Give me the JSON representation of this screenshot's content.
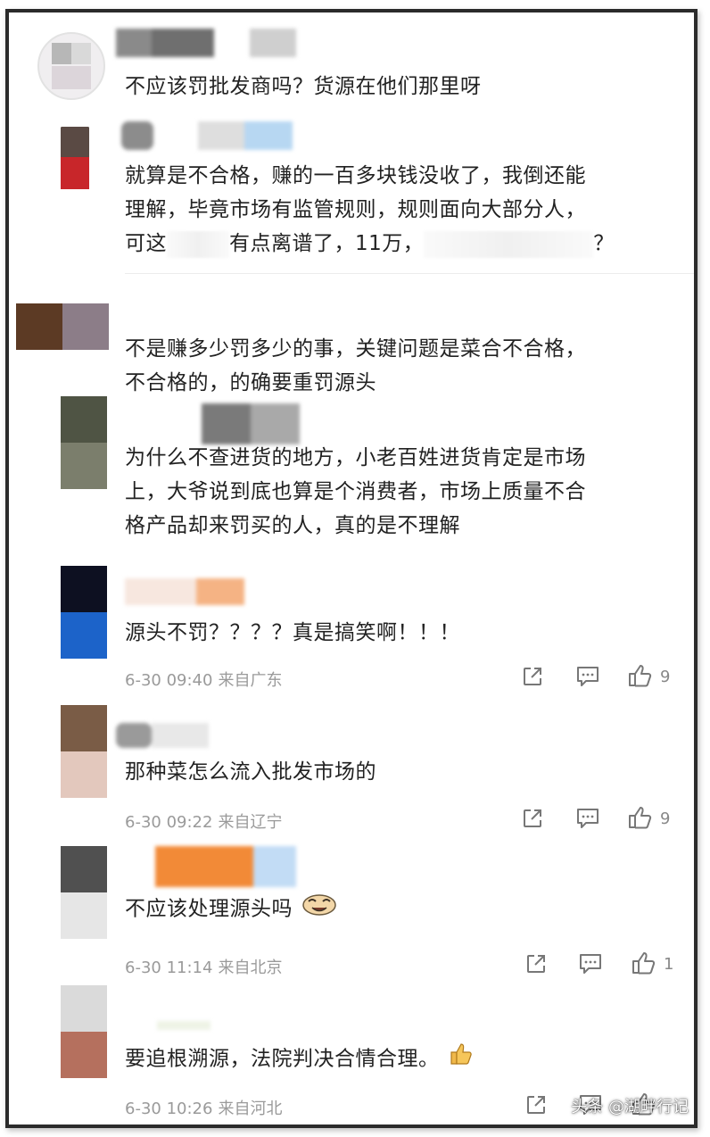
{
  "comments": [
    {
      "lines": [
        "不应该罚批发商吗？货源在他们那里呀"
      ]
    },
    {
      "lines": [
        "就算是不合格，赚的一百多块钱没收了，我倒还能",
        "理解，毕竟市场有监管规则，规则面向大部分人，"
      ],
      "line3_a": "可这",
      "line3_b": "有点离谱了，11万，",
      "line3_c": "？"
    },
    {
      "lines": [
        "不是赚多少罚多少的事，关键问题是菜合不合格，",
        "不合格的，的确要重罚源头"
      ]
    },
    {
      "lines": [
        "为什么不查进货的地方，小老百姓进货肯定是市场",
        "上，大爷说到底也算是个消费者，市场上质量不合",
        "格产品却来罚买的人，真的是不理解"
      ]
    },
    {
      "lines": [
        "源头不罚？？？？真是搞笑啊！！！"
      ],
      "date": "6-30 09:40",
      "loc": "来自广东",
      "likes": "9"
    },
    {
      "lines": [
        "那种菜怎么流入批发市场的"
      ],
      "date": "6-30 09:22",
      "loc": "来自辽宁",
      "likes": "9"
    },
    {
      "lines": [
        "不应该处理源头吗"
      ],
      "date": "6-30 11:14",
      "loc": "来自北京",
      "likes": "1"
    },
    {
      "lines": [
        "要追根溯源，法院判决合情合理。"
      ],
      "date": "6-30 10:26",
      "loc": "来自河北",
      "likes": ""
    }
  ],
  "watermark": "头条 @湖畔行记",
  "icons": {
    "share": "share-icon",
    "comment": "comment-icon",
    "like": "thumbs-up-icon"
  }
}
